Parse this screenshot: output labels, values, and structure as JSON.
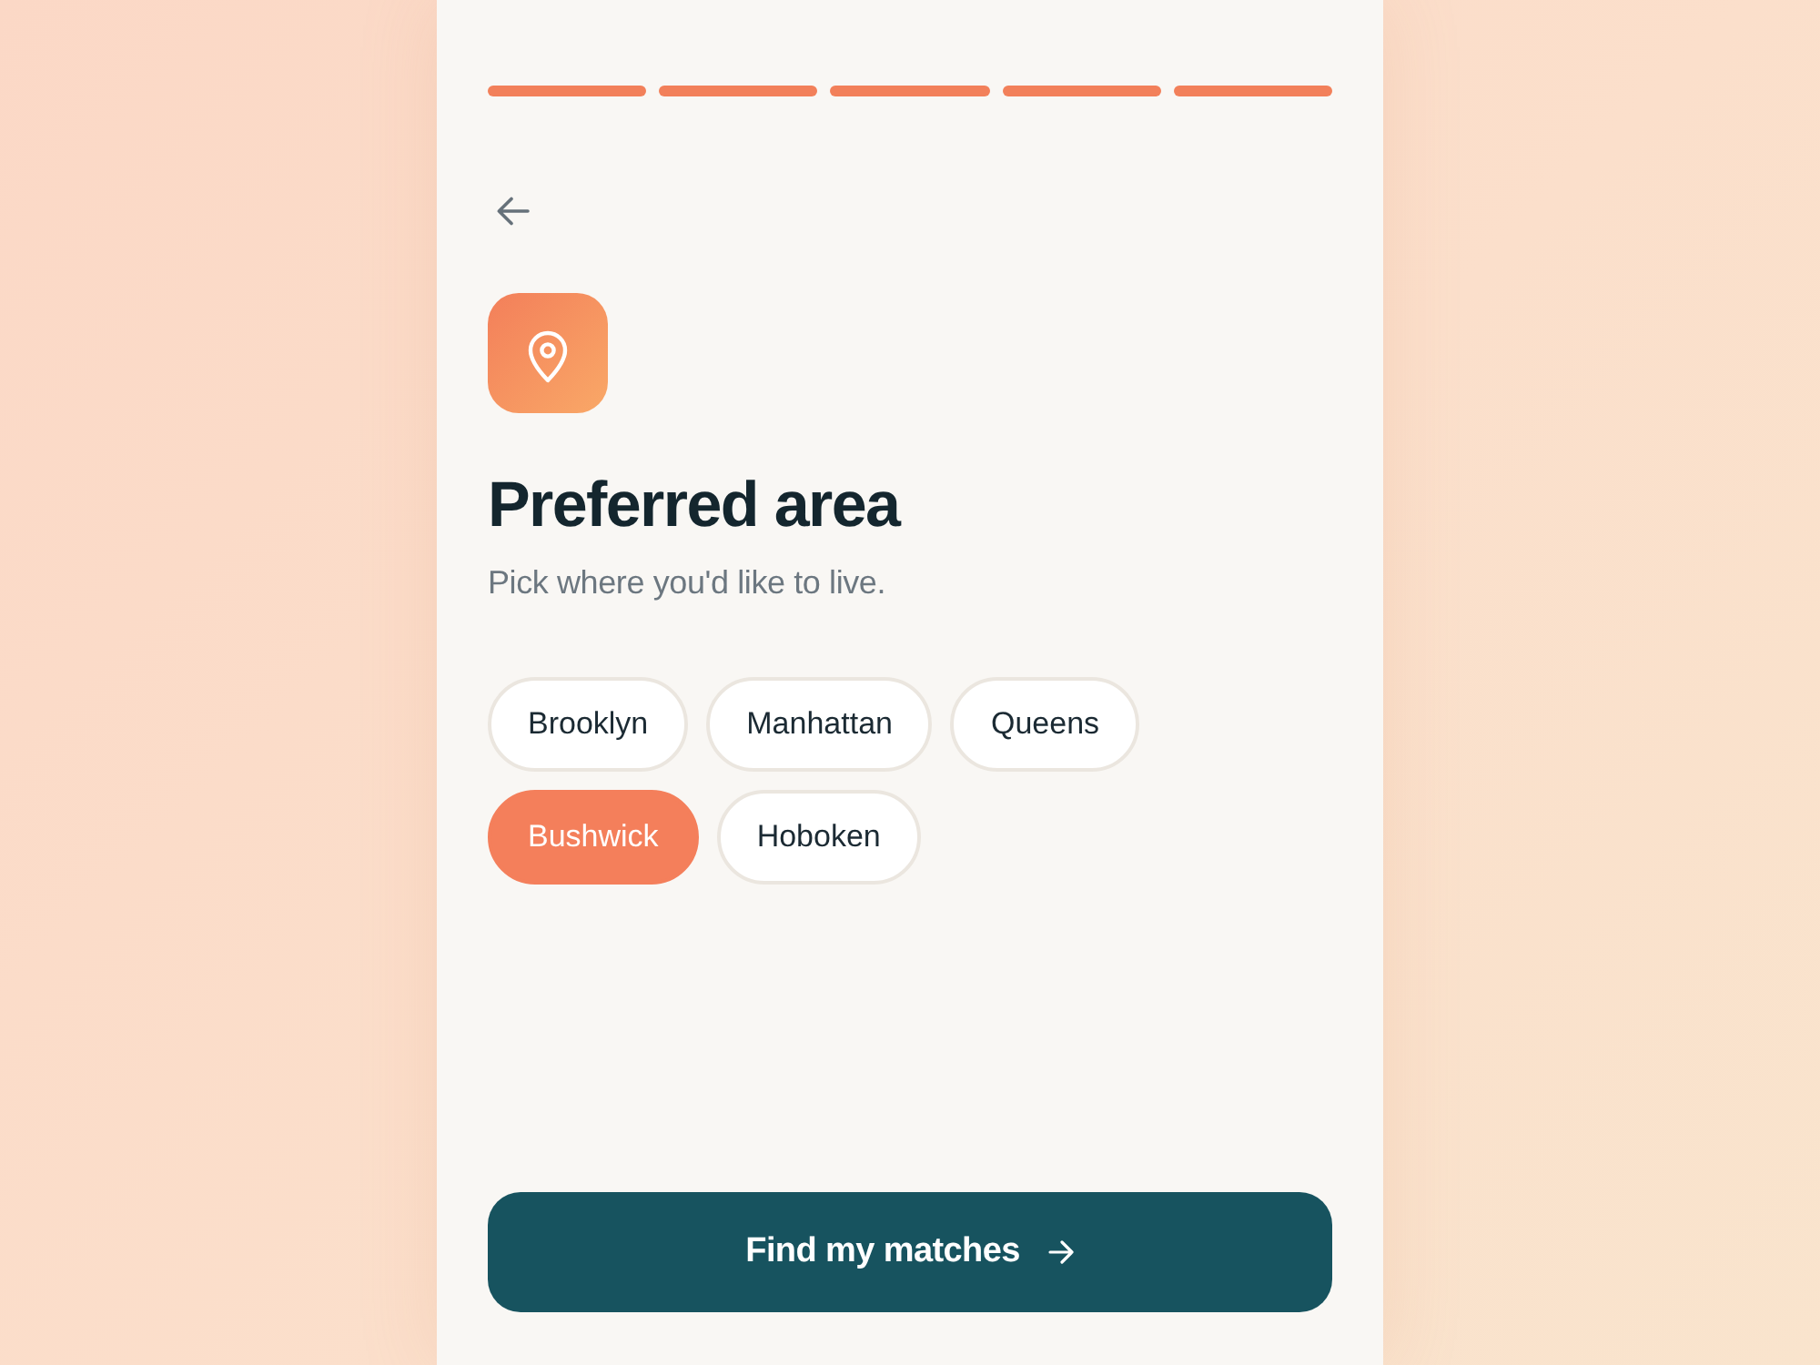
{
  "progress": {
    "steps": [
      {
        "done": true
      },
      {
        "done": true
      },
      {
        "done": true
      },
      {
        "done": true
      },
      {
        "done": true
      }
    ]
  },
  "title": "Preferred area",
  "subtitle": "Pick where you'd like to live.",
  "areas": [
    {
      "label": "Brooklyn",
      "selected": false
    },
    {
      "label": "Manhattan",
      "selected": false
    },
    {
      "label": "Queens",
      "selected": false
    },
    {
      "label": "Bushwick",
      "selected": true
    },
    {
      "label": "Hoboken",
      "selected": false
    }
  ],
  "primary_button": {
    "label": "Find my matches"
  }
}
